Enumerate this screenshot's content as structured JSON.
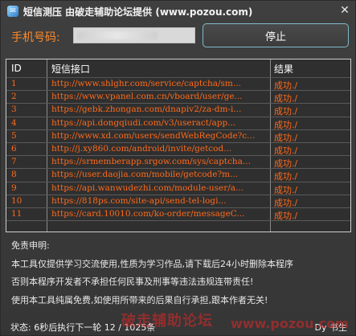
{
  "window": {
    "title": "短信测压 由破走辅助论坛提供 (www.pozou.com)",
    "close_glyph": "✕"
  },
  "phone": {
    "label": "手机号码:",
    "value": ""
  },
  "stop_button": "停止",
  "table": {
    "headers": {
      "id": "ID",
      "api": "短信接口",
      "result": "结果"
    },
    "rows": [
      {
        "id": "1",
        "api": "http://www.shlghr.com/service/captcha/sm...",
        "result": "成功./"
      },
      {
        "id": "2",
        "api": "https://www.vpanel.com.cn/vboard/user/ge...",
        "result": "成功./"
      },
      {
        "id": "3",
        "api": "https://gebk.zhongan.com/dnapiv2/za-dm-i...",
        "result": "成功./"
      },
      {
        "id": "4",
        "api": "https://api.dongqiudi.com/v3/useract/app...",
        "result": "成功./"
      },
      {
        "id": "5",
        "api": "http://www.xd.com/users/sendWebRegCode?c...",
        "result": "成功./"
      },
      {
        "id": "6",
        "api": "http://j.xy860.com/android/invite/getcod...",
        "result": "成功./"
      },
      {
        "id": "7",
        "api": "https://srmemberapp.srgow.com/sys/captcha...",
        "result": "成功./"
      },
      {
        "id": "8",
        "api": "https://user.daojia.com/mobile/getcode?m...",
        "result": "成功./"
      },
      {
        "id": "9",
        "api": "https://api.wanwudezhi.com/module-user/a...",
        "result": "成功./"
      },
      {
        "id": "10",
        "api": "https://818ps.com/site-api/send-tel-logi...",
        "result": "成功./"
      },
      {
        "id": "11",
        "api": "https://card.10010.com/ko-order/messageC...",
        "result": "成功./"
      }
    ]
  },
  "disclaimer": {
    "title": "免责申明:",
    "lines": [
      "本工具仅提供学习交流使用,性质为学习作品,请下载后24小时删除本程序",
      "否则本程序开发者不承担任何民事及刑事等违法违规连带责任!",
      "使用本工具纯属免费,如使用所带来的后果自行承担,跟本作者无关!"
    ]
  },
  "status": {
    "left": "状态: 6秒后执行下一轮 12 / 1025条",
    "right": "Dy 书生"
  },
  "watermark": {
    "text": "破走辅助论坛",
    "url": "www.pozou.com"
  },
  "colors": {
    "accent": "#ff6a1a",
    "button_border": "#7fb9c9",
    "background": "#3a3a3a"
  }
}
